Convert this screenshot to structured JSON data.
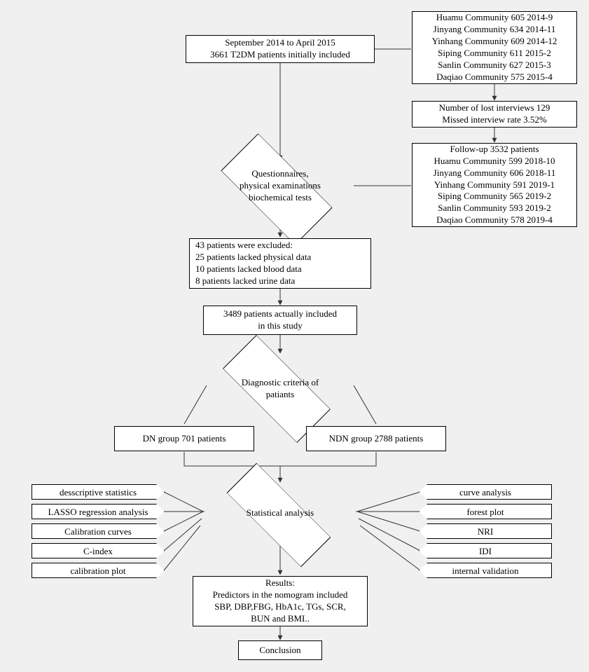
{
  "inclusion": {
    "line1": "September 2014 to April 2015",
    "line2": "3661 T2DM patients initially included"
  },
  "communities_initial": {
    "l1": "Huamu Community 605 2014-9",
    "l2": "Jinyang Community 634 2014-11",
    "l3": "Yinhang Community 609 2014-12",
    "l4": "Siping Community 611 2015-2",
    "l5": "Sanlin Community 627 2015-3",
    "l6": "Daqiao Community 575 2015-4"
  },
  "lost": {
    "l1": "Number of lost interviews 129",
    "l2": "Missed interview rate 3.52%"
  },
  "followup": {
    "l1": "Follow-up 3532 patients",
    "l2": "Huamu Community 599 2018-10",
    "l3": "Jinyang Community 606 2018-11",
    "l4": "Yinhang Community 591 2019-1",
    "l5": "Siping Community 565 2019-2",
    "l6": "Sanlin Community 593 2019-2",
    "l7": "Daqiao Community 578 2019-4"
  },
  "questionnaires": {
    "l1": "Questionnaires,",
    "l2": "physical examinations",
    "l3": "biochemical tests"
  },
  "excluded": {
    "l1": "43 patients were excluded:",
    "l2": "25 patients lacked physical data",
    "l3": "10 patients lacked blood data",
    "l4": "8 patients lacked urine data"
  },
  "actually_included": {
    "l1": "3489 patients actually included",
    "l2": "in this study"
  },
  "diagnostic": {
    "l1": "Diagnostic criteria of",
    "l2": "patiants"
  },
  "dn_group": "DN group  701 patients",
  "ndn_group": "NDN group 2788 patients",
  "stat_analysis": "Statistical analysis",
  "left_tags": {
    "t1": "desscriptive statistics",
    "t2": "LASSO regression analysis",
    "t3": "Calibration curves",
    "t4": "C-index",
    "t5": "calibration plot"
  },
  "right_tags": {
    "t1": "curve analysis",
    "t2": "forest plot",
    "t3": "NRI",
    "t4": "IDI",
    "t5": "internal validation"
  },
  "results": {
    "l1": "Results:",
    "l2": "Predictors in the nomogram included",
    "l3": "SBP, DBP,FBG, HbA1c, TGs, SCR,",
    "l4": "BUN and BMI.."
  },
  "conclusion": "Conclusion"
}
